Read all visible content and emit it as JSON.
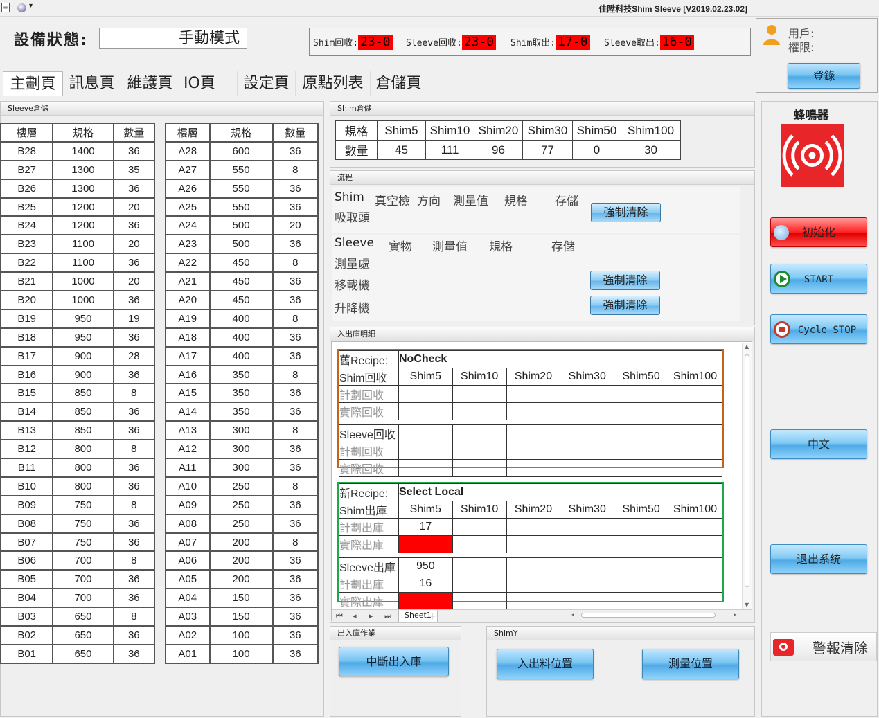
{
  "window": {
    "title": "佳陞科技Shim Sleeve  [V2019.02.23.02]"
  },
  "status": {
    "label": "設備狀態:",
    "mode": "手動模式"
  },
  "counters": [
    {
      "label": "Shim回收:",
      "value": "23-0"
    },
    {
      "label": "Sleeve回收:",
      "value": "23-0"
    },
    {
      "label": "Shim取出:",
      "value": "17-0"
    },
    {
      "label": "Sleeve取出:",
      "value": "16-0"
    }
  ],
  "user": {
    "user_label": "用戶:",
    "perm_label": "權限:",
    "login_button": "登錄"
  },
  "tabs": [
    "主劃頁",
    "訊息頁",
    "維護頁",
    "IO頁",
    "設定頁",
    "原點列表",
    "倉儲頁"
  ],
  "sleeve_storage": {
    "title": "Sleeve倉儲",
    "headers": [
      "樓層",
      "規格",
      "數量"
    ],
    "left_rows": [
      [
        "B28",
        "1400",
        "36"
      ],
      [
        "B27",
        "1300",
        "35"
      ],
      [
        "B26",
        "1300",
        "36"
      ],
      [
        "B25",
        "1200",
        "20"
      ],
      [
        "B24",
        "1200",
        "36"
      ],
      [
        "B23",
        "1100",
        "20"
      ],
      [
        "B22",
        "1100",
        "36"
      ],
      [
        "B21",
        "1000",
        "20"
      ],
      [
        "B20",
        "1000",
        "36"
      ],
      [
        "B19",
        "950",
        "19"
      ],
      [
        "B18",
        "950",
        "36"
      ],
      [
        "B17",
        "900",
        "28"
      ],
      [
        "B16",
        "900",
        "36"
      ],
      [
        "B15",
        "850",
        "8"
      ],
      [
        "B14",
        "850",
        "36"
      ],
      [
        "B13",
        "850",
        "36"
      ],
      [
        "B12",
        "800",
        "8"
      ],
      [
        "B11",
        "800",
        "36"
      ],
      [
        "B10",
        "800",
        "36"
      ],
      [
        "B09",
        "750",
        "8"
      ],
      [
        "B08",
        "750",
        "36"
      ],
      [
        "B07",
        "750",
        "36"
      ],
      [
        "B06",
        "700",
        "8"
      ],
      [
        "B05",
        "700",
        "36"
      ],
      [
        "B04",
        "700",
        "36"
      ],
      [
        "B03",
        "650",
        "8"
      ],
      [
        "B02",
        "650",
        "36"
      ],
      [
        "B01",
        "650",
        "36"
      ]
    ],
    "right_rows": [
      [
        "A28",
        "600",
        "36"
      ],
      [
        "A27",
        "550",
        "8"
      ],
      [
        "A26",
        "550",
        "36"
      ],
      [
        "A25",
        "550",
        "36"
      ],
      [
        "A24",
        "500",
        "20"
      ],
      [
        "A23",
        "500",
        "36"
      ],
      [
        "A22",
        "450",
        "8"
      ],
      [
        "A21",
        "450",
        "36"
      ],
      [
        "A20",
        "450",
        "36"
      ],
      [
        "A19",
        "400",
        "8"
      ],
      [
        "A18",
        "400",
        "36"
      ],
      [
        "A17",
        "400",
        "36"
      ],
      [
        "A16",
        "350",
        "8"
      ],
      [
        "A15",
        "350",
        "36"
      ],
      [
        "A14",
        "350",
        "36"
      ],
      [
        "A13",
        "300",
        "8"
      ],
      [
        "A12",
        "300",
        "36"
      ],
      [
        "A11",
        "300",
        "36"
      ],
      [
        "A10",
        "250",
        "8"
      ],
      [
        "A09",
        "250",
        "36"
      ],
      [
        "A08",
        "250",
        "36"
      ],
      [
        "A07",
        "200",
        "8"
      ],
      [
        "A06",
        "200",
        "36"
      ],
      [
        "A05",
        "200",
        "36"
      ],
      [
        "A04",
        "150",
        "36"
      ],
      [
        "A03",
        "150",
        "36"
      ],
      [
        "A02",
        "100",
        "36"
      ],
      [
        "A01",
        "100",
        "36"
      ]
    ]
  },
  "shim_storage": {
    "title": "Shim倉儲",
    "spec_label": "規格",
    "qty_label": "數量",
    "specs": [
      "Shim5",
      "Shim10",
      "Shim20",
      "Shim30",
      "Shim50",
      "Shim100"
    ],
    "quantities": [
      "45",
      "111",
      "96",
      "77",
      "0",
      "30"
    ]
  },
  "flow": {
    "title": "流程",
    "shim_header": [
      "Shim",
      "真空檢",
      "方向",
      "測量值",
      "規格",
      "存儲"
    ],
    "shim_row": "吸取頭",
    "sleeve_header": [
      "Sleeve",
      "實物",
      "測量值",
      "規格",
      "存儲"
    ],
    "sleeve_rows": [
      "測量處",
      "移載機",
      "升降機"
    ],
    "clear_button": "強制清除"
  },
  "inout_detail": {
    "title": "入出庫明細",
    "old_recipe_label": "舊Recipe:",
    "old_recipe_value": "NoCheck",
    "shim_recover": "Shim回收",
    "planned_recover": "計劃回收",
    "actual_recover": "實際回收",
    "sleeve_recover": "Sleeve回收",
    "new_recipe_label": "新Recipe:",
    "new_recipe_value": "Select Local",
    "shim_out": "Shim出庫",
    "planned_out": "計劃出庫",
    "actual_out": "實際出庫",
    "sleeve_out": "Sleeve出庫",
    "shim_cols": [
      "Shim5",
      "Shim10",
      "Shim20",
      "Shim30",
      "Shim50",
      "Shim100"
    ],
    "planned_shim5": "17",
    "sleeve_spec": "950",
    "planned_sleeve": "16",
    "sheet_tab": "Sheet1"
  },
  "inout_op": {
    "title": "出入庫作業",
    "stop_button": "中斷出入庫"
  },
  "shimy": {
    "title": "ShimY",
    "load_button": "入出料位置",
    "measure_button": "測量位置"
  },
  "right_panel": {
    "buzzer_label": "蜂鳴器",
    "init_button": "初始化",
    "start_button": "START",
    "cycle_stop_button": "Cycle STOP",
    "lang_button": "中文",
    "exit_button": "退出系统",
    "alarm_clear_button": "警報清除"
  },
  "colors": {
    "red_value": "#ff0000",
    "recipe_old_border": "#c0651c",
    "recipe_new_border": "#1ea84a",
    "button_blue": "#4faae6"
  }
}
